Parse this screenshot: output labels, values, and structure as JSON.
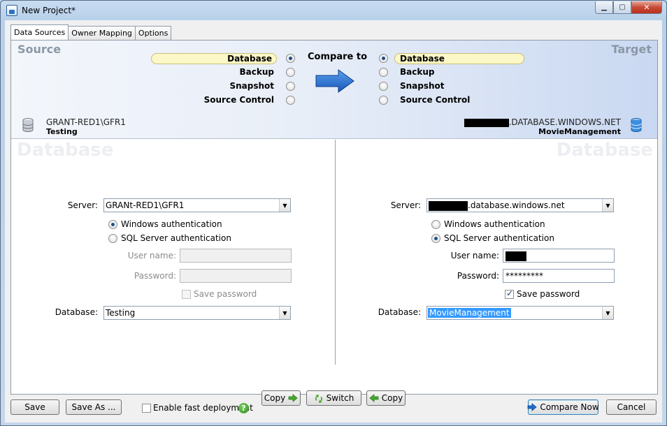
{
  "window": {
    "title": "New Project*"
  },
  "tabs": [
    "Data Sources",
    "Owner Mapping",
    "Options"
  ],
  "header": {
    "source_title": "Source",
    "target_title": "Target",
    "compare_to": "Compare to",
    "source_options": [
      {
        "label": "Database",
        "selected": true
      },
      {
        "label": "Backup",
        "selected": false
      },
      {
        "label": "Snapshot",
        "selected": false
      },
      {
        "label": "Source Control",
        "selected": false
      }
    ],
    "target_options": [
      {
        "label": "Database",
        "selected": true
      },
      {
        "label": "Backup",
        "selected": false
      },
      {
        "label": "Snapshot",
        "selected": false
      },
      {
        "label": "Source Control",
        "selected": false
      }
    ],
    "source_conn": {
      "server": "GRANT-RED1\\GFR1",
      "database": "Testing"
    },
    "target_conn": {
      "server_suffix": ".DATABASE.WINDOWS.NET",
      "database": "MovieManagement"
    }
  },
  "source": {
    "watermark": "Database",
    "server_label": "Server:",
    "server_value": "GRANt-RED1\\GFR1",
    "auth_windows": "Windows authentication",
    "auth_sql": "SQL Server authentication",
    "auth_selected": "windows",
    "username_label": "User name:",
    "username_value": "",
    "password_label": "Password:",
    "password_value": "",
    "save_password_label": "Save password",
    "save_password_checked": false,
    "database_label": "Database:",
    "database_value": "Testing"
  },
  "target": {
    "watermark": "Database",
    "server_label": "Server:",
    "server_suffix": ".database.windows.net",
    "auth_windows": "Windows authentication",
    "auth_sql": "SQL Server authentication",
    "auth_selected": "sql",
    "username_label": "User name:",
    "password_label": "Password:",
    "password_value": "*********",
    "save_password_label": "Save password",
    "save_password_checked": true,
    "database_label": "Database:",
    "database_value": "MovieManagement"
  },
  "center_buttons": {
    "copy_right": "Copy",
    "switch": "Switch",
    "copy_left": "Copy"
  },
  "footer": {
    "save": "Save",
    "save_as": "Save As ...",
    "fast_deployment": "Enable fast deployment",
    "fast_deployment_checked": false,
    "compare_now": "Compare Now",
    "cancel": "Cancel"
  },
  "colors": {
    "accent": "#1d4f86",
    "highlight": "#fbf7c6",
    "arrow": "#1f6fd1",
    "green": "#46a82e"
  }
}
